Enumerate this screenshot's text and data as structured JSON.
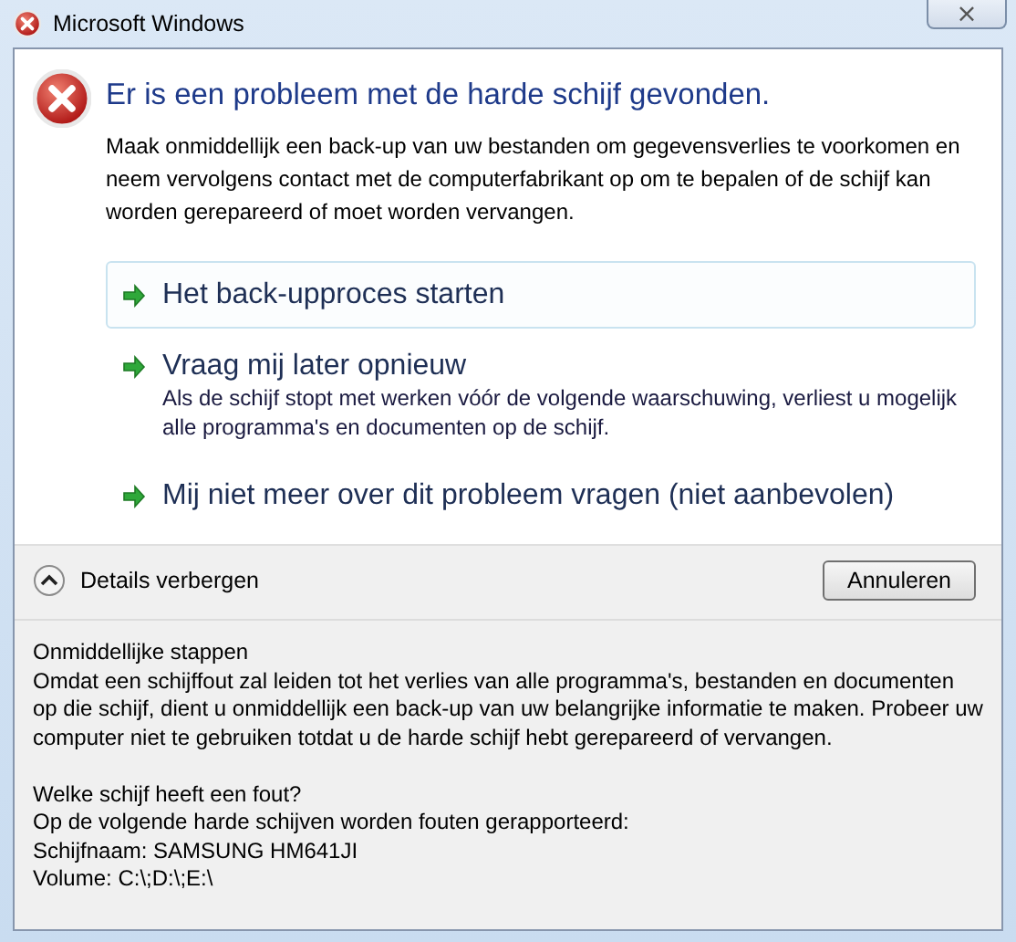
{
  "window": {
    "title": "Microsoft Windows",
    "close": "×"
  },
  "heading": "Er is een probleem met de harde schijf gevonden.",
  "message": "Maak onmiddellijk een back-up van uw bestanden om gegevensverlies te voorkomen en neem vervolgens contact met de computerfabrikant op om te bepalen of de schijf kan worden gerepareerd of moet worden vervangen.",
  "commands": [
    {
      "label": "Het back-upproces starten",
      "highlighted": true
    },
    {
      "label": "Vraag mij later opnieuw",
      "note": "Als de schijf stopt met werken vóór de volgende waarschuwing, verliest u mogelijk alle programma's en documenten op de schijf.",
      "highlighted": false
    },
    {
      "label": "Mij niet meer over dit probleem vragen (niet aanbevolen)",
      "highlighted": false
    }
  ],
  "details_toggle": {
    "label": "Details verbergen",
    "expanded": true
  },
  "buttons": [
    "Annuleren"
  ],
  "details": [
    {
      "kind": "text",
      "text": "Onmiddellijke stappen"
    },
    {
      "kind": "text",
      "text": "Omdat een schijffout zal leiden tot het verlies van alle programma's, bestanden en documenten op die schijf, dient u onmiddellijk een back-up van uw belangrijke informatie te maken. Probeer uw computer niet te gebruiken totdat u de harde schijf hebt gerepareerd of vervangen."
    },
    {
      "kind": "gap"
    },
    {
      "kind": "text",
      "text": "Welke schijf heeft een fout?"
    },
    {
      "kind": "text",
      "text": "Op de volgende harde schijven worden fouten gerapporteerd:"
    },
    {
      "kind": "text",
      "text": "Schijfnaam: SAMSUNG HM641JI"
    },
    {
      "kind": "text",
      "text": "Volume: C:\\;D:\\;E:\\"
    }
  ]
}
